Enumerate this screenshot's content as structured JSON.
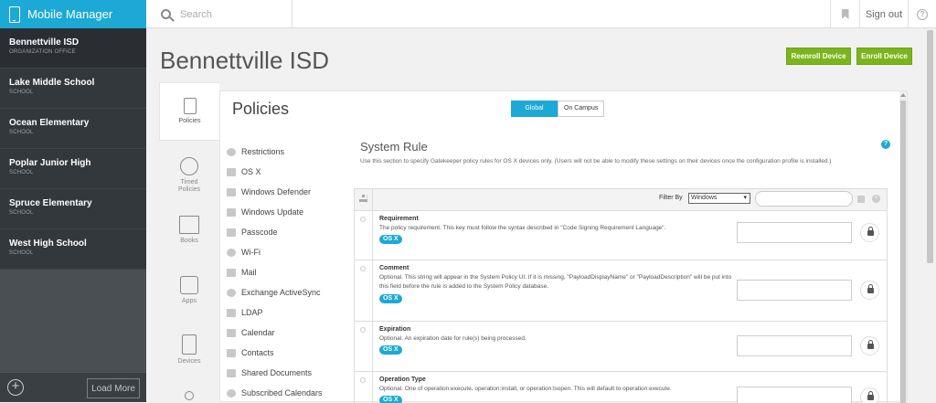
{
  "app": {
    "title": "Mobile Manager"
  },
  "search": {
    "placeholder": "Search"
  },
  "header": {
    "signout": "Sign out"
  },
  "sidebar": {
    "schools": [
      {
        "name": "Bennettville ISD",
        "type": "ORGANIZATION OFFICE"
      },
      {
        "name": "Lake Middle School",
        "type": "SCHOOL"
      },
      {
        "name": "Ocean Elementary",
        "type": "SCHOOL"
      },
      {
        "name": "Poplar Junior High",
        "type": "SCHOOL"
      },
      {
        "name": "Spruce Elementary",
        "type": "SCHOOL"
      },
      {
        "name": "West High School",
        "type": "SCHOOL"
      }
    ],
    "load_more": "Load More"
  },
  "page": {
    "title": "Bennettville ISD",
    "reenroll_label": "Reenroll Device",
    "enroll_label": "Enroll Device"
  },
  "tabs": [
    {
      "label": "Policies"
    },
    {
      "label": "Timed Policies"
    },
    {
      "label": "Books"
    },
    {
      "label": "Apps"
    },
    {
      "label": "Devices"
    }
  ],
  "panel": {
    "title": "Policies",
    "toggle": {
      "global": "Global",
      "campus": "On Campus"
    },
    "policies": [
      "Restrictions",
      "OS X",
      "Windows Defender",
      "Windows Update",
      "Passcode",
      "Wi-Fi",
      "Mail",
      "Exchange ActiveSync",
      "LDAP",
      "Calendar",
      "Contacts",
      "Shared Documents",
      "Subscribed Calendars"
    ],
    "rule": {
      "title": "System Rule",
      "description": "Use this section to specify Gatekeeper policy rules for OS X devices only. (Users will not be able to modify these settings on their devices once the configuration profile is installed.)",
      "filter_label": "Filter By",
      "filter_value": "Windows",
      "rows": [
        {
          "title": "Requirement",
          "text": "The policy requirement. This key must follow the syntax described in \"Code Signing Requirement Language\".",
          "badge": "OS X"
        },
        {
          "title": "Comment",
          "text": "Optional. This string will appear in the System Policy UI. If it is missing, \"PayloadDisplayName\" or \"PayloadDescription\" will be put into this field before the rule is added to the System Policy database.",
          "badge": "OS X"
        },
        {
          "title": "Expiration",
          "text": "Optional. An expiration date for rule(s) being processed.",
          "badge": "OS X"
        },
        {
          "title": "Operation Type",
          "text": "Optional. One of operation:execute, operation:install, or operation:lsopen. This will default to operation:execute.",
          "badge": "OS X"
        }
      ]
    }
  },
  "colors": {
    "brand": "#1ca9d6",
    "green": "#7ab51d",
    "sidebar": "#33383c"
  }
}
